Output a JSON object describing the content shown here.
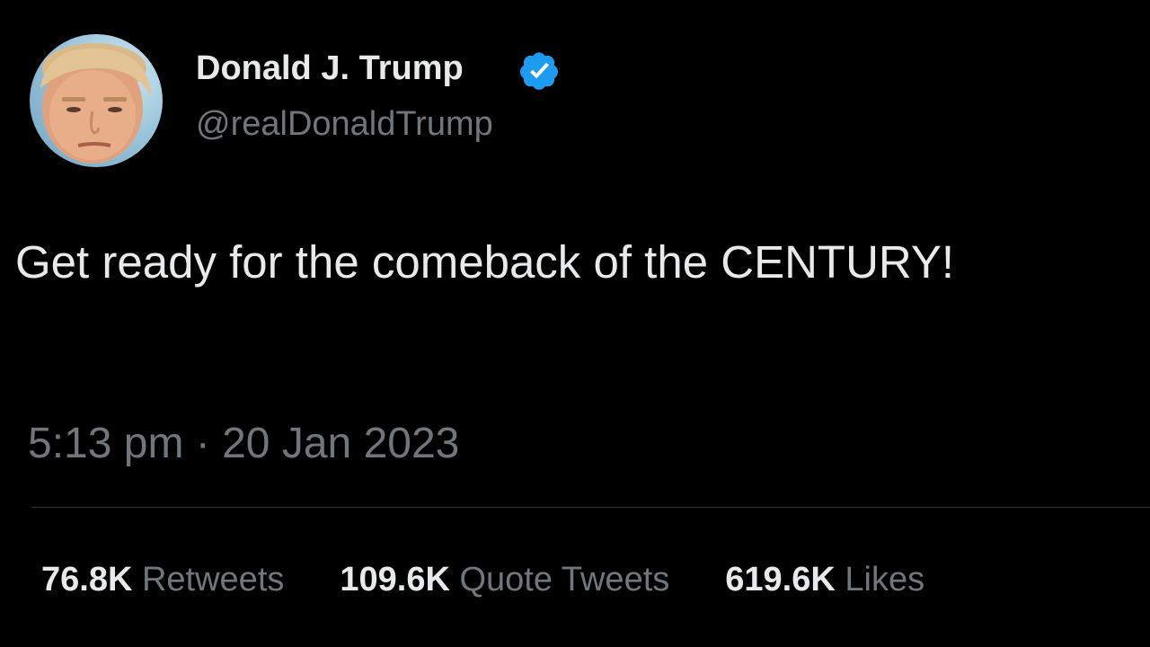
{
  "author": {
    "display_name": "Donald J. Trump",
    "handle": "@realDonaldTrump",
    "verified": true,
    "verified_badge_color": "#1d9bf0"
  },
  "tweet": {
    "text": "Get ready for the comeback of the CENTURY!",
    "time": "5:13 pm",
    "separator": "·",
    "date": "20 Jan 2023"
  },
  "stats": {
    "retweets": {
      "count": "76.8K",
      "label": "Retweets"
    },
    "quote_tweets": {
      "count": "109.6K",
      "label": "Quote Tweets"
    },
    "likes": {
      "count": "619.6K",
      "label": "Likes"
    }
  },
  "colors": {
    "background": "#000000",
    "primary_text": "#e7e9ea",
    "secondary_text": "#71767b",
    "divider": "#2f3336"
  }
}
